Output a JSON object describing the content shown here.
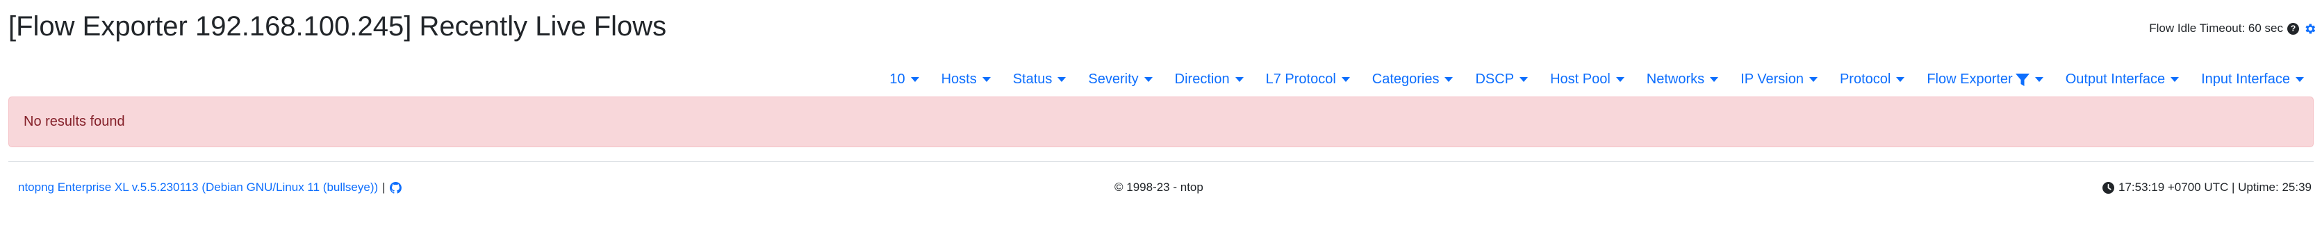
{
  "header": {
    "title": "[Flow Exporter 192.168.100.245] Recently Live Flows",
    "idle_timeout": "Flow Idle Timeout: 60 sec"
  },
  "filters": [
    {
      "label": "10"
    },
    {
      "label": "Hosts"
    },
    {
      "label": "Status"
    },
    {
      "label": "Severity"
    },
    {
      "label": "Direction"
    },
    {
      "label": "L7 Protocol"
    },
    {
      "label": "Categories"
    },
    {
      "label": "DSCP"
    },
    {
      "label": "Host Pool"
    },
    {
      "label": "Networks"
    },
    {
      "label": "IP Version"
    },
    {
      "label": "Protocol"
    },
    {
      "label": "Flow Exporter"
    },
    {
      "label": "Output Interface"
    },
    {
      "label": "Input Interface"
    }
  ],
  "alert": {
    "message": "No results found"
  },
  "footer": {
    "version": "ntopng Enterprise XL v.5.5.230113 (Debian GNU/Linux 11 (bullseye))",
    "separator": "|",
    "copyright": "© 1998-23 - ntop",
    "status": "17:53:19 +0700 UTC | Uptime: 25:39"
  },
  "colors": {
    "link": "#0d6efd",
    "alert_bg": "#f8d7da",
    "alert_text": "#842029"
  },
  "icons": {
    "help": "question-circle-icon",
    "settings": "gear-icon",
    "active_filter": "funnel-icon",
    "repo": "github-icon",
    "time": "clock-icon"
  }
}
